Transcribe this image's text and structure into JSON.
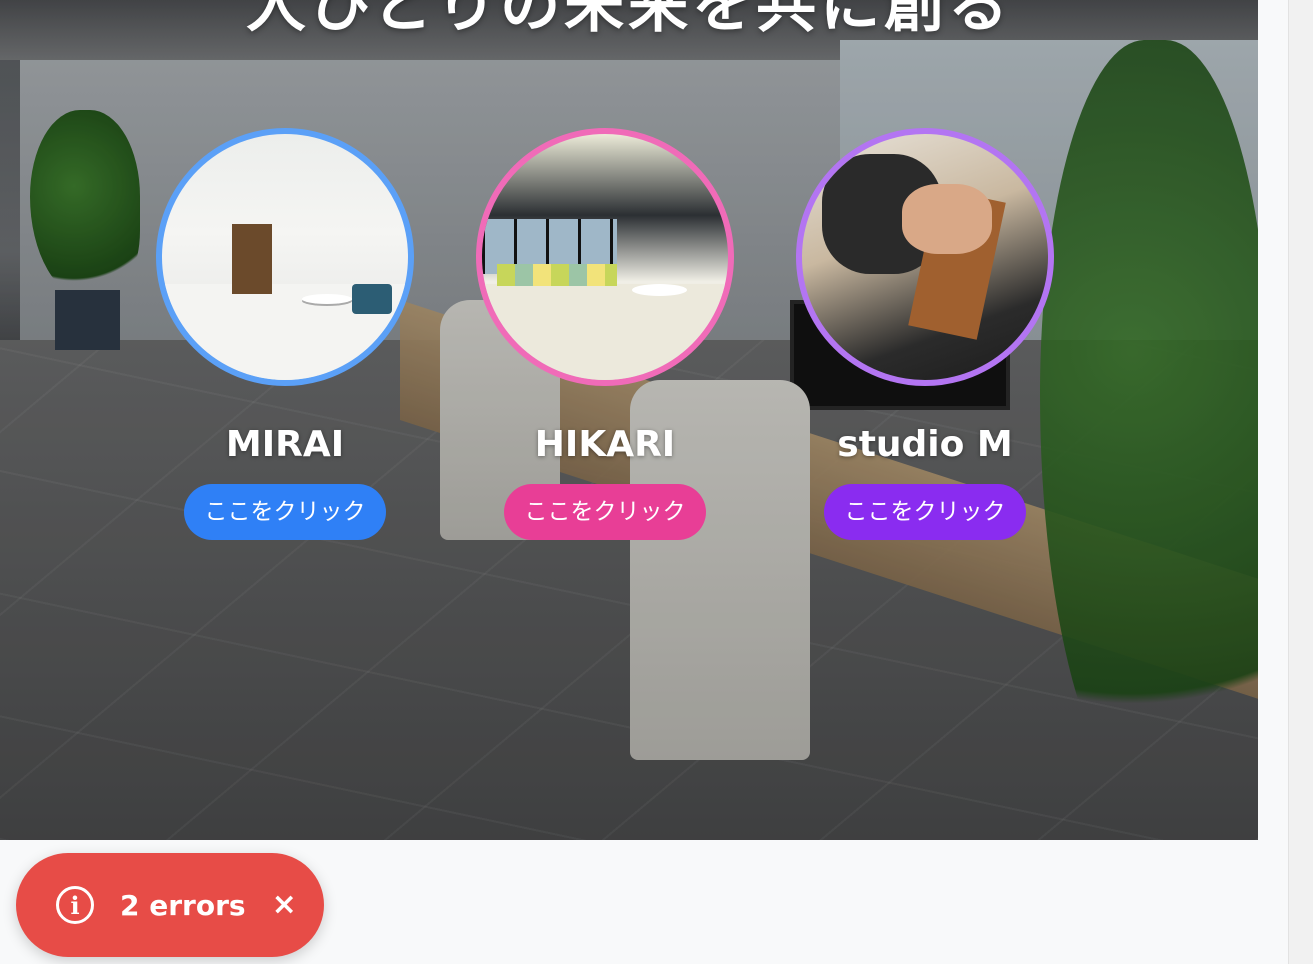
{
  "hero": {
    "title": "人ひとりの未来を共に創る"
  },
  "facilities": [
    {
      "name": "MIRAI",
      "button_label": "ここをクリック",
      "accent": "#2f80f6",
      "ring": "#5ba0f7"
    },
    {
      "name": "HIKARI",
      "button_label": "ここをクリック",
      "accent": "#e83e96",
      "ring": "#f06bb8"
    },
    {
      "name": "studio M",
      "button_label": "ここをクリック",
      "accent": "#8a2cf0",
      "ring": "#b375f2"
    }
  ],
  "error_toast": {
    "icon": "info-icon",
    "label": "2 errors",
    "close_icon": "close-icon",
    "background": "#e74c47"
  }
}
